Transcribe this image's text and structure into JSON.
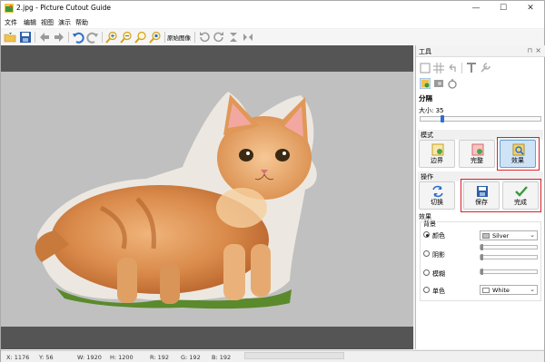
{
  "window": {
    "title": "2.jpg - Picture Cutout Guide"
  },
  "menu": [
    "文件",
    "编辑",
    "视图",
    "演示",
    "帮助"
  ],
  "toolbar": {
    "original_label": "原始图像"
  },
  "panel": {
    "title": "工具",
    "split_section": "分隔",
    "size_label": "大小: 35",
    "size_value": 35,
    "mode_section": "模式",
    "mode_buttons": [
      "边界",
      "完整",
      "效果"
    ],
    "ops_section": "操作",
    "ops_buttons": [
      "切换",
      "保存",
      "完成"
    ],
    "effects_section": "效果",
    "background_group": "背景",
    "options": [
      "颜色",
      "阴影",
      "模糊",
      "单色"
    ],
    "color_select": "Silver",
    "mono_select": "White"
  },
  "status": {
    "x": "X: 1176",
    "y": "Y: 56",
    "w": "W: 1920",
    "h": "H: 1200",
    "r": "R: 192",
    "g": "G: 192",
    "b": "B: 192"
  },
  "colors": {
    "canvas_dark": "#555555",
    "background_silver": "#c0c0c0",
    "highlight_red": "#d8202a",
    "accent_blue": "#2b6fd0"
  }
}
